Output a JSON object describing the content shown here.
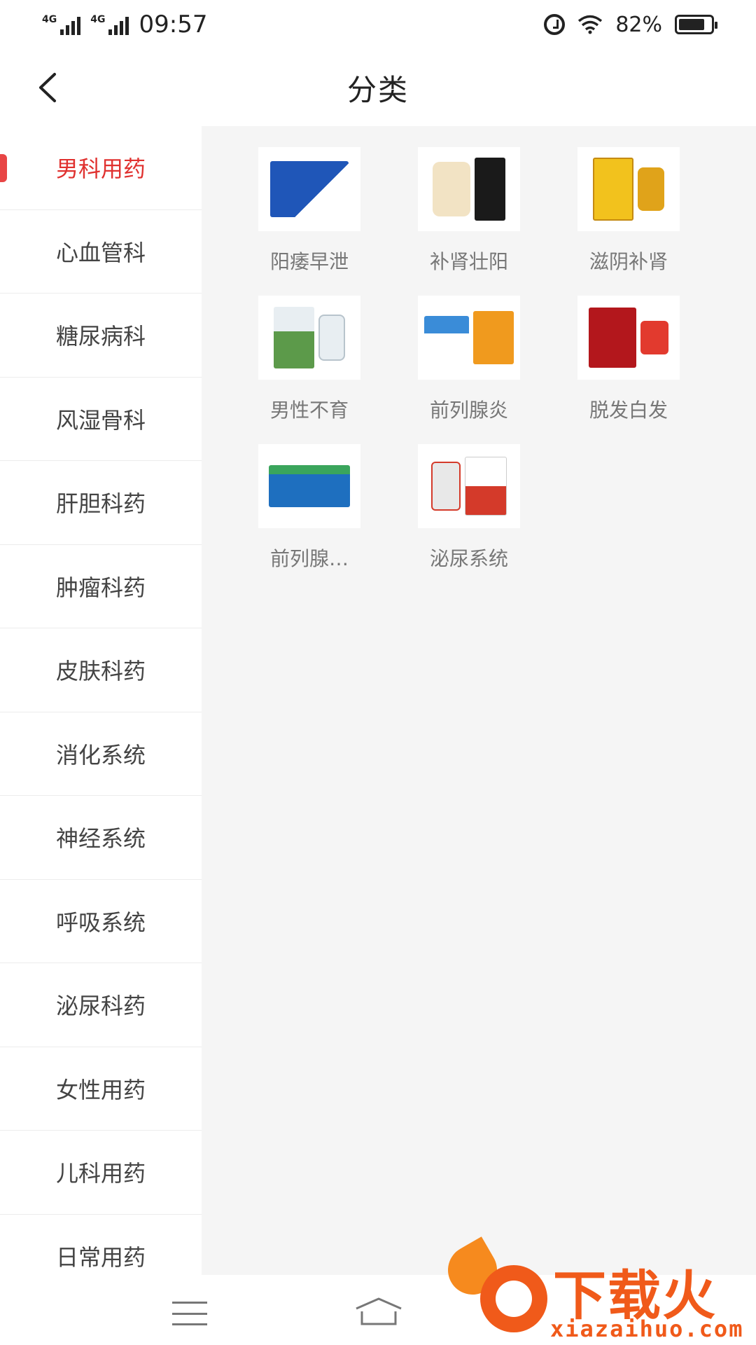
{
  "status_bar": {
    "network_1": "4G",
    "network_2": "4G",
    "time": "09:57",
    "battery_percent": "82%",
    "battery_level": 0.82
  },
  "header": {
    "title": "分类",
    "back_icon": "chevron-left-icon"
  },
  "sidebar": {
    "items": [
      {
        "label": "男科用药",
        "active": true
      },
      {
        "label": "心血管科"
      },
      {
        "label": "糖尿病科"
      },
      {
        "label": "风湿骨科"
      },
      {
        "label": "肝胆科药"
      },
      {
        "label": "肿瘤科药"
      },
      {
        "label": "皮肤科药"
      },
      {
        "label": "消化系统"
      },
      {
        "label": "神经系统"
      },
      {
        "label": "呼吸系统"
      },
      {
        "label": "泌尿科药"
      },
      {
        "label": "女性用药"
      },
      {
        "label": "儿科用药"
      },
      {
        "label": "日常用药"
      }
    ],
    "accent_color": "#e0312f"
  },
  "categories": [
    {
      "label": "阳痿早泄",
      "colors": [
        "#1f56b8",
        "#ffffff"
      ]
    },
    {
      "label": "补肾壮阳",
      "colors": [
        "#f2e3c4",
        "#1a1a1a"
      ]
    },
    {
      "label": "滋阴补肾",
      "colors": [
        "#f2c21d",
        "#e0a31a"
      ]
    },
    {
      "label": "男性不育",
      "colors": [
        "#5c9a4a",
        "#e8eef2"
      ]
    },
    {
      "label": "前列腺炎",
      "colors": [
        "#f09a1e",
        "#3a8cd8"
      ]
    },
    {
      "label": "脱发白发",
      "colors": [
        "#b3171c",
        "#e23a2e"
      ]
    },
    {
      "label": "前列腺…",
      "colors": [
        "#1e6fbf",
        "#3aa55c"
      ]
    },
    {
      "label": "泌尿系统",
      "colors": [
        "#e8e8e8",
        "#d43a2a"
      ]
    }
  ],
  "bottom_nav": {
    "menu_icon": "menu-icon",
    "home_icon": "home-icon"
  },
  "watermark": {
    "brand": "下载火",
    "url": "xiazaihuo.com"
  }
}
